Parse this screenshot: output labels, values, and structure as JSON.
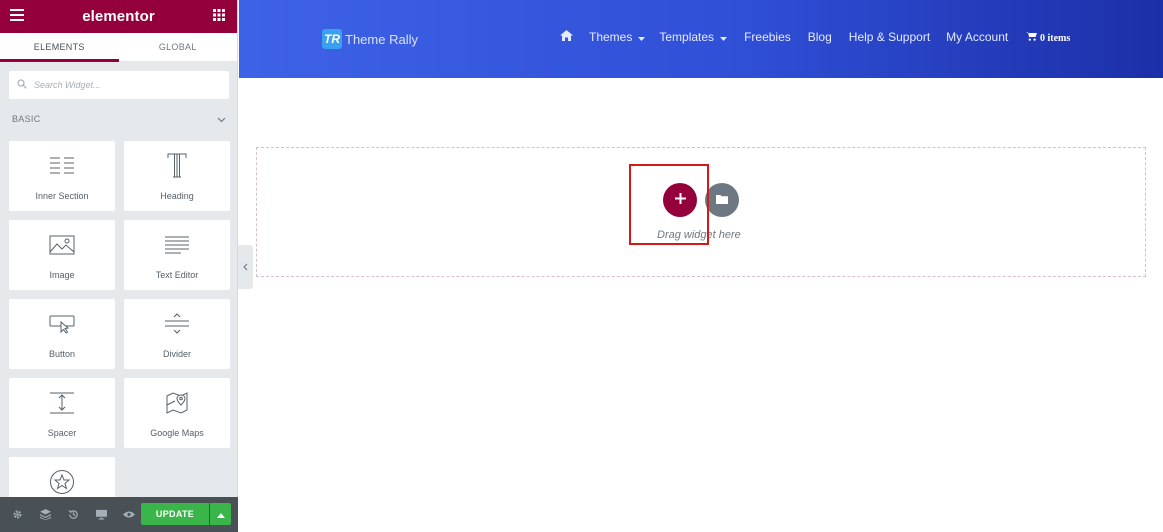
{
  "panel": {
    "logo": "elementor",
    "tabs": [
      {
        "label": "ELEMENTS",
        "active": true
      },
      {
        "label": "GLOBAL",
        "active": false
      }
    ],
    "search": {
      "placeholder": "Search Widget..."
    },
    "category": {
      "label": "BASIC"
    },
    "widgets": [
      {
        "label": "Inner Section",
        "icon": "inner-section-icon"
      },
      {
        "label": "Heading",
        "icon": "heading-icon"
      },
      {
        "label": "Image",
        "icon": "image-icon"
      },
      {
        "label": "Text Editor",
        "icon": "text-editor-icon"
      },
      {
        "label": "Button",
        "icon": "button-icon"
      },
      {
        "label": "Divider",
        "icon": "divider-icon"
      },
      {
        "label": "Spacer",
        "icon": "spacer-icon"
      },
      {
        "label": "Google Maps",
        "icon": "google-maps-icon"
      },
      {
        "label": "",
        "icon": "star-icon"
      }
    ],
    "footer": {
      "icons": [
        "settings-icon",
        "navigator-icon",
        "history-icon",
        "responsive-mode-icon",
        "preview-icon"
      ],
      "update_label": "UPDATE"
    },
    "colors": {
      "brand": "#93003c",
      "update": "#39b54a",
      "footer": "#495157"
    }
  },
  "site": {
    "brand": {
      "mark": "TR",
      "name": "Theme Rally"
    },
    "nav": [
      {
        "label": "",
        "icon": "home-icon"
      },
      {
        "label": "Themes",
        "dropdown": true
      },
      {
        "label": "Templates",
        "dropdown": true
      },
      {
        "label": "Freebies"
      },
      {
        "label": "Blog"
      },
      {
        "label": "Help & Support"
      },
      {
        "label": "My Account"
      }
    ],
    "cart_label": "0 items"
  },
  "canvas": {
    "drag_text": "Drag widget here"
  }
}
